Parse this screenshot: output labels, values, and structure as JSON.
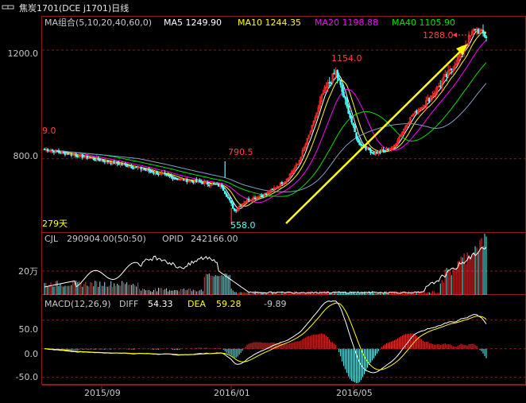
{
  "header": {
    "title": "焦炭1701(DCE j1701)日线",
    "icon": "chain-link-icon"
  },
  "colors": {
    "bg": "#000000",
    "frame": "#8b1a1a",
    "grid": "#8b1a1a",
    "up": "#ff3030",
    "down": "#54ffff",
    "ma5": "#ffffff",
    "ma10": "#ffff00",
    "ma20": "#ff00ff",
    "ma40": "#00e000",
    "ma60": "#7fa0c0",
    "arrow": "#ffff00",
    "label": "#c8c8c8"
  },
  "price_panel": {
    "legend": [
      {
        "label": "MA组合(5,10,20,40,60,0)",
        "color": "#c8c8c8"
      },
      {
        "label": "MA5 1249.90",
        "color": "#ffffff"
      },
      {
        "label": "MA10 1244.35",
        "color": "#ffff00"
      },
      {
        "label": "MA20 1198.88",
        "color": "#ff00ff"
      },
      {
        "label": "MA40 1105.90",
        "color": "#00e000"
      }
    ],
    "y_ticks": [
      "1200.0",
      "800.0"
    ],
    "annotations": {
      "high_1288": "1288.0",
      "high_1154": "1154.0",
      "high_790": "790.5",
      "low_558": "558.0",
      "left_cut": "9.0",
      "days": "279天"
    }
  },
  "volume_panel": {
    "legend": [
      {
        "label": "CJL",
        "color": "#c8c8c8"
      },
      {
        "label": "290904.00(50:50)",
        "color": "#c8c8c8"
      },
      {
        "label": "OPID",
        "color": "#c8c8c8"
      },
      {
        "label": "242166.00",
        "color": "#c8c8c8"
      }
    ],
    "y_ticks": [
      "20万"
    ]
  },
  "macd_panel": {
    "legend": [
      {
        "label": "MACD(12,26,9)",
        "color": "#c8c8c8"
      },
      {
        "label": "DIFF",
        "color": "#c8c8c8"
      },
      {
        "label": "54.33",
        "color": "#ffffff"
      },
      {
        "label": "DEA",
        "color": "#ffff00"
      },
      {
        "label": "59.28",
        "color": "#ffff00"
      },
      {
        "label": "-9.89",
        "color": "#c8c8c8"
      }
    ],
    "y_ticks": [
      "50.0",
      "0.0",
      "-50.0"
    ]
  },
  "x_axis": {
    "ticks": [
      "2015/09",
      "2016/01",
      "2016/05"
    ]
  },
  "chart_data": {
    "type": "candlestick",
    "title": "焦炭1701(DCE j1701)日线",
    "x_ticks": [
      "2015/09",
      "2016/01",
      "2016/05"
    ],
    "price_range": [
      530,
      1320
    ],
    "price_ticks": [
      1200,
      800
    ],
    "key_prices": {
      "high_right": 1288.0,
      "high_mid": 1154.0,
      "spike_high": 790.5,
      "low": 558.0
    },
    "close_path": {
      "x_index": [
        0,
        18,
        40,
        60,
        85,
        100,
        112,
        120,
        128,
        140,
        152,
        160,
        168,
        176,
        184,
        190,
        198,
        208,
        220,
        232,
        240,
        248,
        256,
        264,
        272,
        279
      ],
      "close": [
        835,
        815,
        790,
        765,
        725,
        712,
        700,
        610,
        650,
        670,
        720,
        780,
        900,
        1040,
        1120,
        1010,
        860,
        820,
        840,
        960,
        1000,
        1060,
        1120,
        1200,
        1280,
        1250
      ]
    },
    "series": [
      {
        "name": "MA5",
        "last": 1249.9
      },
      {
        "name": "MA10",
        "last": 1244.35
      },
      {
        "name": "MA20",
        "last": 1198.88
      },
      {
        "name": "MA40",
        "last": 1105.9
      }
    ],
    "volume": {
      "CJL": 290904.0,
      "OPID": 242166.0,
      "tick": "20万"
    },
    "macd": {
      "DIFF": 54.33,
      "DEA": 59.28,
      "MACD": -9.89,
      "range": [
        -60,
        90
      ],
      "ticks": [
        50,
        0,
        -50
      ]
    }
  }
}
